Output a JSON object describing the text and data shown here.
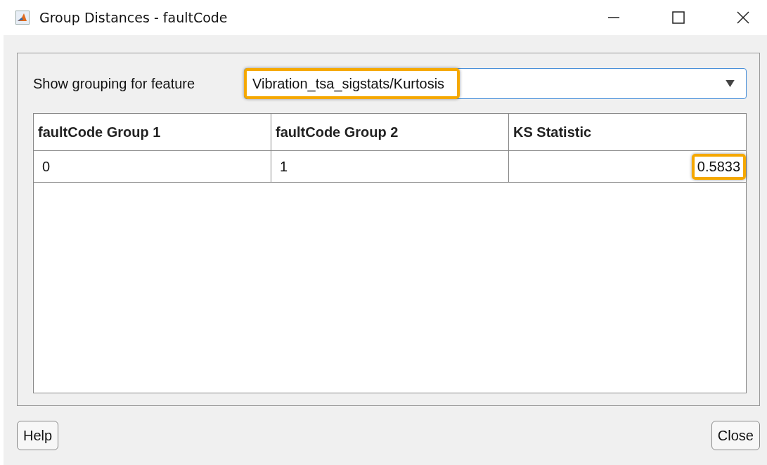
{
  "window": {
    "title": "Group Distances - faultCode"
  },
  "feature": {
    "label": "Show grouping for feature",
    "value": "Vibration_tsa_sigstats/Kurtosis",
    "highlighted": true
  },
  "table": {
    "columns": [
      "faultCode Group 1",
      "faultCode Group 2",
      "KS Statistic"
    ],
    "rows": [
      {
        "cells": [
          {
            "text": "0",
            "right_aligned": false,
            "highlighted": false
          },
          {
            "text": "1",
            "right_aligned": false,
            "highlighted": false
          },
          {
            "text": "0.5833",
            "right_aligned": true,
            "highlighted": true
          }
        ]
      }
    ]
  },
  "buttons": {
    "help": "Help",
    "close": "Close"
  }
}
